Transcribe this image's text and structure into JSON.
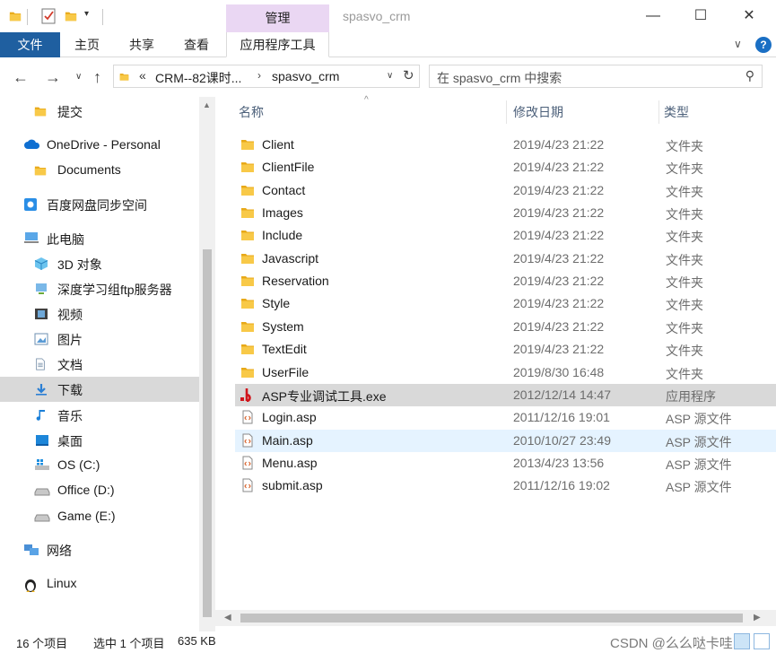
{
  "titlebar": {
    "manage_label": "管理",
    "title": "spasvo_crm",
    "minimize": "—",
    "maximize": "☐",
    "close": "✕",
    "dropdown": "▾"
  },
  "ribbon": {
    "file": "文件",
    "home": "主页",
    "share": "共享",
    "view": "查看",
    "app_tools": "应用程序工具",
    "expand": "∨",
    "help": "?"
  },
  "nav": {
    "back": "←",
    "forward": "→",
    "recent": "∨",
    "up": "↑",
    "address_prefix": "«",
    "address_segment1": "CRM--82课时...",
    "address_arrow": "›",
    "address_segment2": "spasvo_crm",
    "address_dropdown": "∨",
    "refresh": "↻",
    "search_placeholder": "在 spasvo_crm 中搜索",
    "search_glyph": "⚲"
  },
  "navpane": {
    "items": [
      {
        "label": "提交",
        "icon": "folder-icon"
      },
      {
        "label": "OneDrive - Personal",
        "icon": "onedrive-icon"
      },
      {
        "label": "Documents",
        "icon": "folder-icon"
      },
      {
        "label": "百度网盘同步空间",
        "icon": "baidu-netdisk-icon"
      },
      {
        "label": "此电脑",
        "icon": "this-pc-icon"
      },
      {
        "label": "3D 对象",
        "icon": "3d-objects-icon"
      },
      {
        "label": "深度学习组ftp服务器",
        "icon": "network-location-icon"
      },
      {
        "label": "视频",
        "icon": "videos-icon"
      },
      {
        "label": "图片",
        "icon": "pictures-icon"
      },
      {
        "label": "文档",
        "icon": "documents-icon"
      },
      {
        "label": "下载",
        "icon": "downloads-icon"
      },
      {
        "label": "音乐",
        "icon": "music-icon"
      },
      {
        "label": "桌面",
        "icon": "desktop-icon"
      },
      {
        "label": "OS (C:)",
        "icon": "windows-drive-icon"
      },
      {
        "label": "Office (D:)",
        "icon": "drive-icon"
      },
      {
        "label": "Game (E:)",
        "icon": "drive-icon"
      },
      {
        "label": "网络",
        "icon": "network-icon"
      },
      {
        "label": "Linux",
        "icon": "linux-penguin-icon"
      }
    ],
    "scroll_up": "▲"
  },
  "list": {
    "headers": {
      "name": "名称",
      "date": "修改日期",
      "type": "类型"
    },
    "sort_arrow": "^",
    "files": [
      {
        "name": "Client",
        "date": "2019/4/23 21:22",
        "type": "文件夹",
        "icon": "folder-icon"
      },
      {
        "name": "ClientFile",
        "date": "2019/4/23 21:22",
        "type": "文件夹",
        "icon": "folder-icon"
      },
      {
        "name": "Contact",
        "date": "2019/4/23 21:22",
        "type": "文件夹",
        "icon": "folder-icon"
      },
      {
        "name": "Images",
        "date": "2019/4/23 21:22",
        "type": "文件夹",
        "icon": "folder-icon"
      },
      {
        "name": "Include",
        "date": "2019/4/23 21:22",
        "type": "文件夹",
        "icon": "folder-icon"
      },
      {
        "name": "Javascript",
        "date": "2019/4/23 21:22",
        "type": "文件夹",
        "icon": "folder-icon"
      },
      {
        "name": "Reservation",
        "date": "2019/4/23 21:22",
        "type": "文件夹",
        "icon": "folder-icon"
      },
      {
        "name": "Style",
        "date": "2019/4/23 21:22",
        "type": "文件夹",
        "icon": "folder-icon"
      },
      {
        "name": "System",
        "date": "2019/4/23 21:22",
        "type": "文件夹",
        "icon": "folder-icon"
      },
      {
        "name": "TextEdit",
        "date": "2019/4/23 21:22",
        "type": "文件夹",
        "icon": "folder-icon"
      },
      {
        "name": "UserFile",
        "date": "2019/8/30 16:48",
        "type": "文件夹",
        "icon": "folder-icon"
      },
      {
        "name": "ASP专业调试工具.exe",
        "date": "2012/12/14 14:47",
        "type": "应用程序",
        "icon": "exe-icon"
      },
      {
        "name": "Login.asp",
        "date": "2011/12/16 19:01",
        "type": "ASP 源文件",
        "icon": "asp-file-icon"
      },
      {
        "name": "Main.asp",
        "date": "2010/10/27 23:49",
        "type": "ASP 源文件",
        "icon": "asp-file-icon"
      },
      {
        "name": "Menu.asp",
        "date": "2013/4/23 13:56",
        "type": "ASP 源文件",
        "icon": "asp-file-icon"
      },
      {
        "name": "submit.asp",
        "date": "2011/12/16 19:02",
        "type": "ASP 源文件",
        "icon": "asp-file-icon"
      }
    ],
    "selected_index": 11,
    "hover_index": 13,
    "scroll_left": "◀",
    "scroll_right": "▶"
  },
  "status": {
    "count": "16 个项目",
    "selected": "选中 1 个项目",
    "size": "635 KB",
    "watermark": "CSDN @么么哒卡哇"
  },
  "colors": {
    "accent": "#1f5fa0",
    "manage_tab": "#ead7f3",
    "selection": "#d9d9d9",
    "hover": "#e5f3ff",
    "folder": "#f5c342"
  }
}
